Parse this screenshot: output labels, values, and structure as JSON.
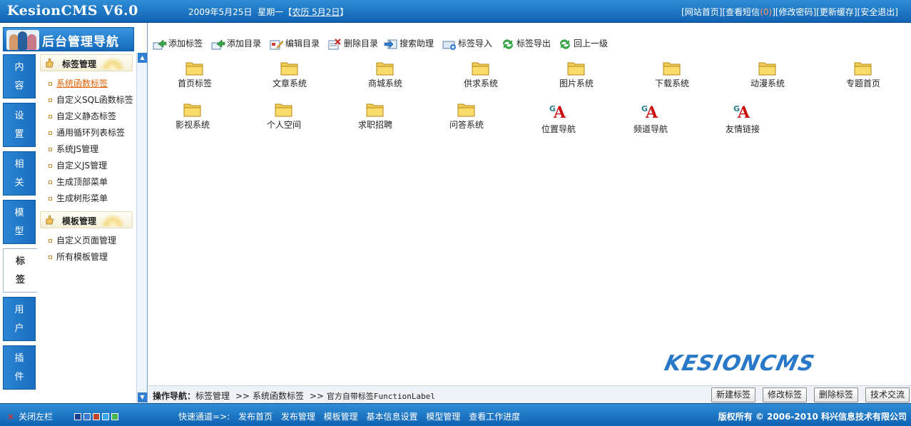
{
  "app": {
    "title": "KesionCMS V6.0"
  },
  "header": {
    "date": "2009年5月25日",
    "weekday": "星期一",
    "lunar_open": "【",
    "lunar": "农历 5月2日",
    "lunar_close": "】",
    "links": [
      {
        "label": "[网站首页]"
      },
      {
        "label": "[查看短信"
      },
      {
        "label": "(0)"
      },
      {
        "label": "]"
      },
      {
        "label": "[修改密码]"
      },
      {
        "label": "[更新缓存]"
      },
      {
        "label": "[安全退出]"
      }
    ]
  },
  "sidebar": {
    "title": "后台管理导航",
    "tabs": [
      {
        "c1": "内",
        "c2": "容"
      },
      {
        "c1": "设",
        "c2": "置"
      },
      {
        "c1": "相",
        "c2": "关"
      },
      {
        "c1": "模",
        "c2": "型"
      },
      {
        "c1": "标",
        "c2": "签"
      },
      {
        "c1": "用",
        "c2": "户"
      },
      {
        "c1": "插",
        "c2": "件"
      }
    ],
    "groups": [
      {
        "title": "标签管理"
      },
      {
        "title": "模板管理"
      }
    ],
    "items": [
      {
        "label": "系统函数标签"
      },
      {
        "label": "自定义SQL函数标签"
      },
      {
        "label": "自定义静态标签"
      },
      {
        "label": "通用循环列表标签"
      },
      {
        "label": "系统JS管理"
      },
      {
        "label": "自定义JS管理"
      },
      {
        "label": "生成顶部菜单"
      },
      {
        "label": "生成树形菜单"
      },
      {
        "label": "自定义页面管理"
      },
      {
        "label": "所有模板管理"
      }
    ]
  },
  "toolbar": {
    "buttons": [
      {
        "label": "添加标签"
      },
      {
        "label": "添加目录"
      },
      {
        "label": "编辑目录"
      },
      {
        "label": "删除目录"
      },
      {
        "label": "搜索助理"
      },
      {
        "label": "标签导入"
      },
      {
        "label": "标签导出"
      },
      {
        "label": "回上一级"
      }
    ]
  },
  "folders": [
    {
      "label": "首页标签"
    },
    {
      "label": "文章系统"
    },
    {
      "label": "商城系统"
    },
    {
      "label": "供求系统"
    },
    {
      "label": "图片系统"
    },
    {
      "label": "下载系统"
    },
    {
      "label": "动漫系统"
    },
    {
      "label": "专题首页"
    },
    {
      "label": "影视系统"
    },
    {
      "label": "个人空间"
    },
    {
      "label": "求职招聘"
    },
    {
      "label": "问答系统"
    }
  ],
  "labels": [
    {
      "label": "位置导航"
    },
    {
      "label": "频道导航"
    },
    {
      "label": "友情链接"
    }
  ],
  "brand": "KESIONCMS",
  "opbar": {
    "prefix": "操作导航：",
    "crumb1": "标签管理",
    "sep": ">>",
    "crumb2": "系统函数标签",
    "crumb3": "官方自带标签FunctionLabel",
    "buttons": [
      {
        "label": "新建标签"
      },
      {
        "label": "修改标签"
      },
      {
        "label": "删除标签"
      },
      {
        "label": "技术交流"
      }
    ]
  },
  "footer": {
    "close": "关闭左栏",
    "quick_prefix": "快速通道=>:",
    "quick_links": [
      {
        "label": "发布首页"
      },
      {
        "label": "发布管理"
      },
      {
        "label": "模板管理"
      },
      {
        "label": "基本信息设置"
      },
      {
        "label": "模型管理"
      },
      {
        "label": "查看工作进度"
      }
    ],
    "copyright": "版权所有 © 2006-2010 科兴信息技术有限公司"
  },
  "colors": {
    "header_blue": "#1468bb",
    "active_menu": "#e06000",
    "swatches": [
      "#1d3d8c",
      "#3b7ad0",
      "#c0452a",
      "#35a6e8",
      "#48b850"
    ]
  }
}
